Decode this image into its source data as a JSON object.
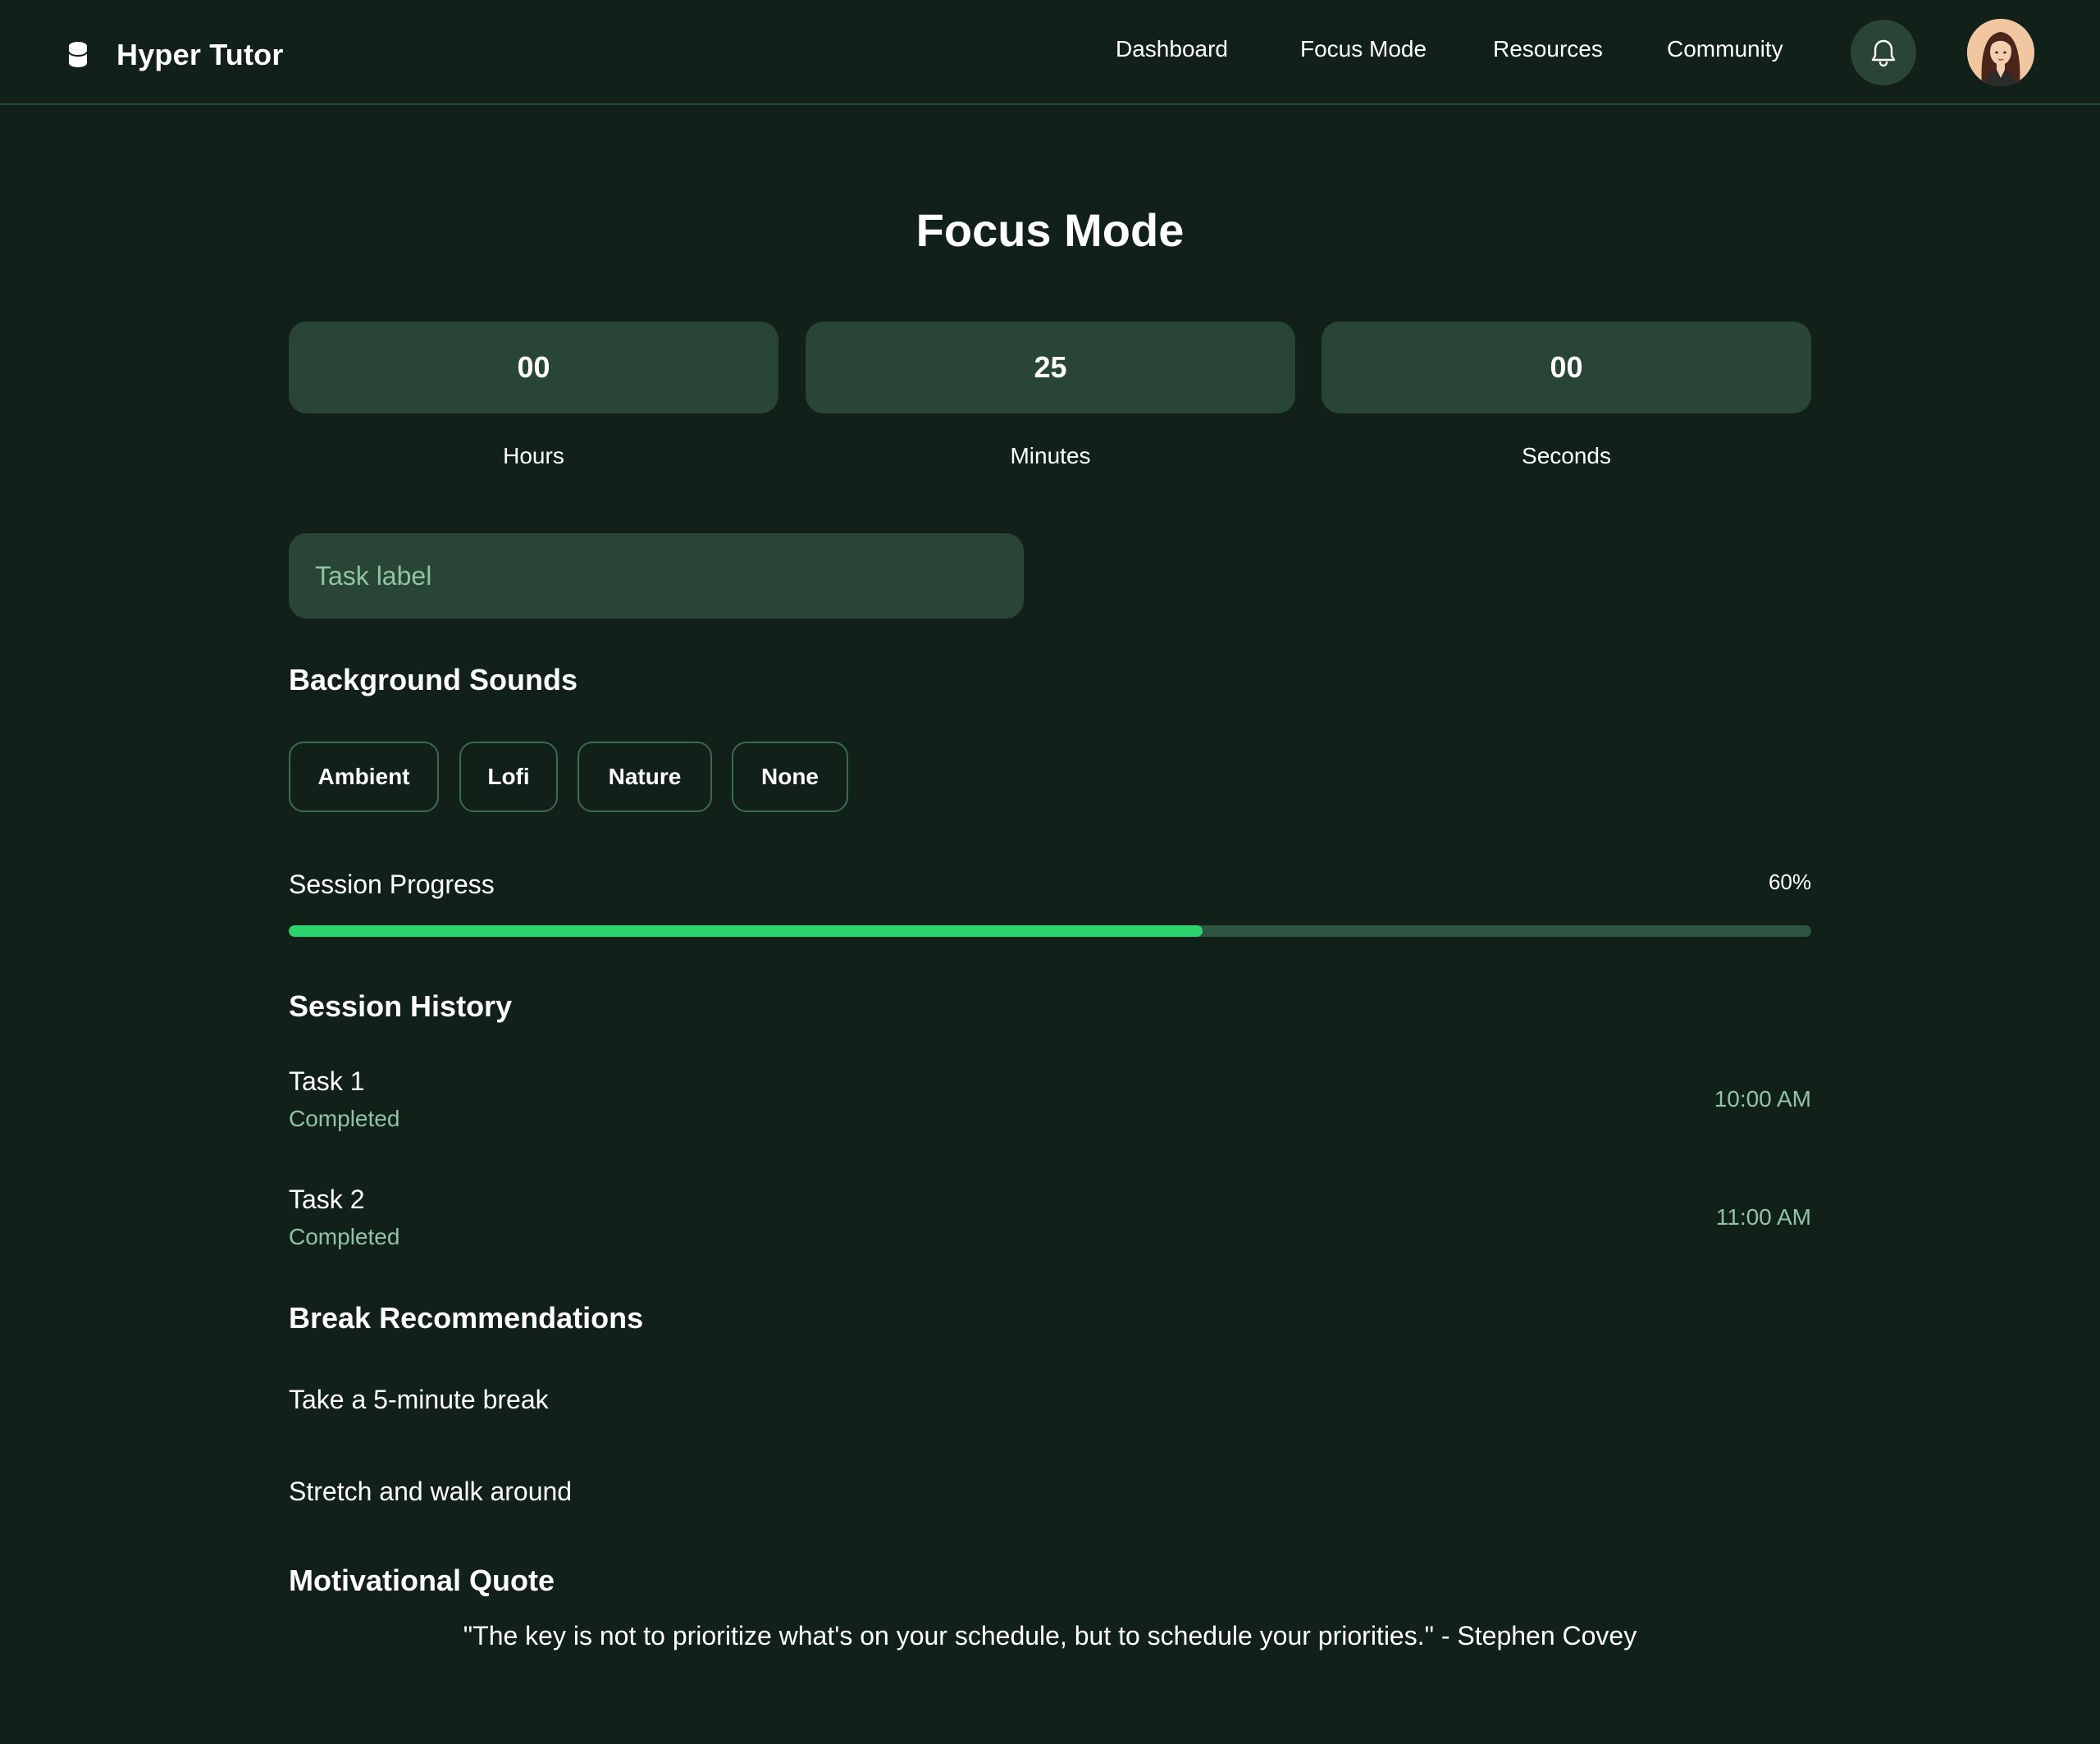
{
  "app": {
    "name": "Hyper Tutor"
  },
  "nav": {
    "items": [
      "Dashboard",
      "Focus Mode",
      "Resources",
      "Community"
    ],
    "notification_icon": "bell-icon",
    "avatar": "user-avatar"
  },
  "page": {
    "title": "Focus Mode"
  },
  "timer": {
    "hours": "00",
    "minutes": "25",
    "seconds": "00",
    "hours_label": "Hours",
    "minutes_label": "Minutes",
    "seconds_label": "Seconds"
  },
  "task_input": {
    "placeholder": "Task label",
    "value": ""
  },
  "background_sounds": {
    "title": "Background Sounds",
    "options": [
      "Ambient",
      "Lofi",
      "Nature",
      "None"
    ]
  },
  "session_progress": {
    "label": "Session Progress",
    "percent_text": "60%",
    "fraction": 0.6
  },
  "session_history": {
    "title": "Session History",
    "items": [
      {
        "task": "Task 1",
        "status": "Completed",
        "time": "10:00 AM"
      },
      {
        "task": "Task 2",
        "status": "Completed",
        "time": "11:00 AM"
      }
    ]
  },
  "break_recommendations": {
    "title": "Break Recommendations",
    "items": [
      "Take a 5-minute break",
      "Stretch and walk around"
    ]
  },
  "motivational_quote": {
    "title": "Motivational Quote",
    "text": "\"The key is not to prioritize what's on your schedule, but to schedule your priorities.\" - Stephen Covey"
  },
  "colors": {
    "background": "#112019",
    "panel": "#294535",
    "accent": "#2dd36f",
    "muted_text": "#8fc5a5"
  }
}
